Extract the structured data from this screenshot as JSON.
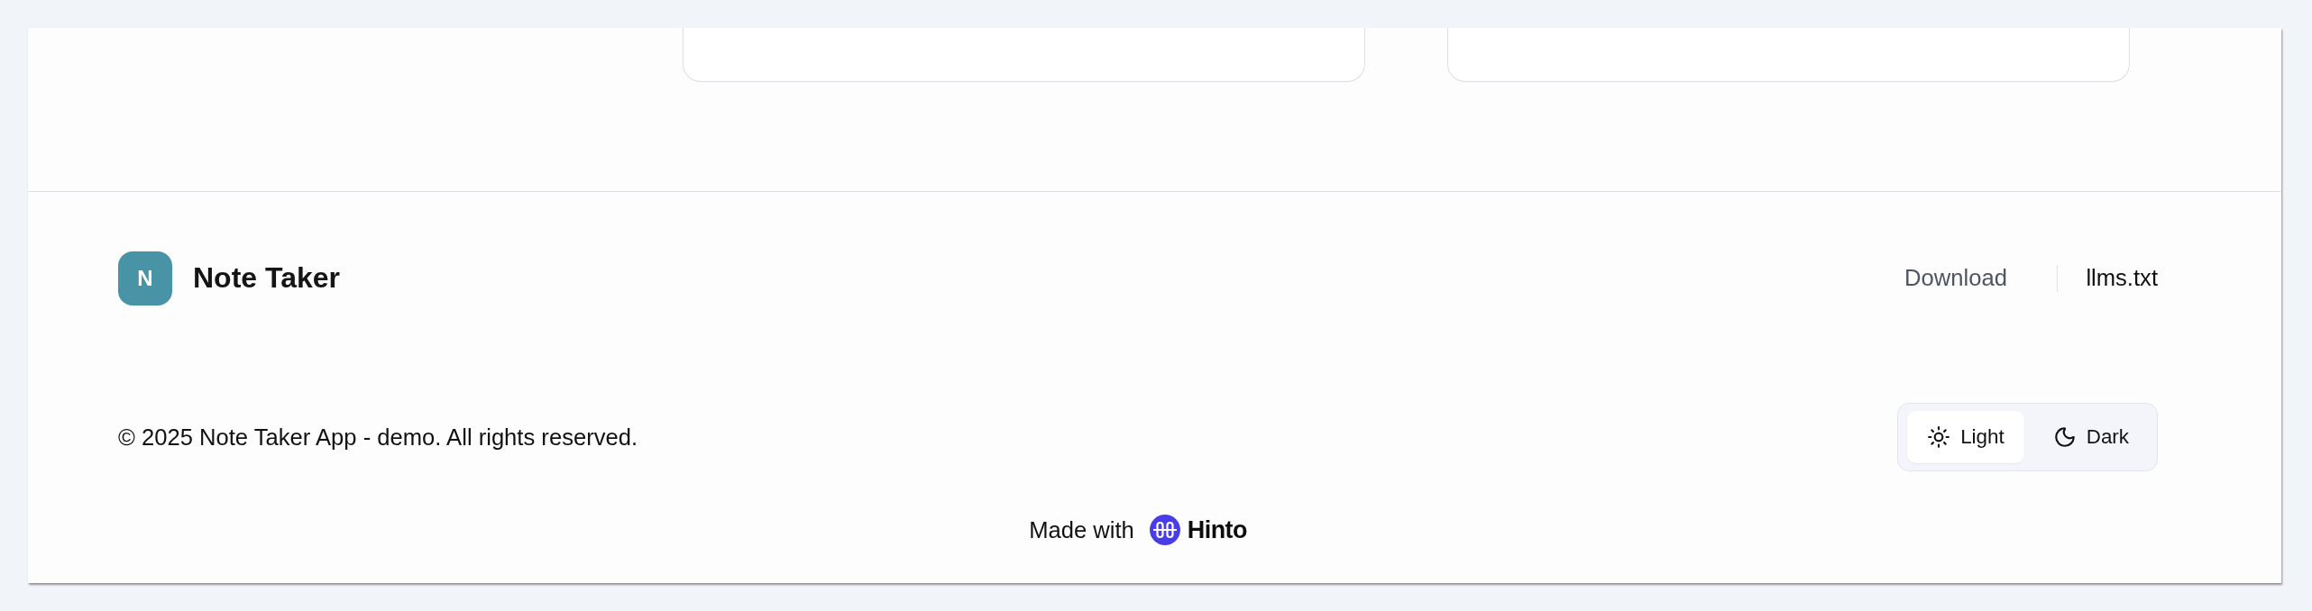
{
  "footer": {
    "brand": {
      "logo_letter": "N",
      "name": "Note Taker"
    },
    "links": [
      {
        "label": "Download",
        "hovered": false
      },
      {
        "label": "llms.txt",
        "hovered": true
      }
    ],
    "copyright": "© 2025 Note Taker App - demo. All rights reserved.",
    "theme_toggle": [
      {
        "kind": "light",
        "label": "Light",
        "selected": true
      },
      {
        "kind": "dark",
        "label": "Dark",
        "selected": false
      }
    ],
    "made_with": {
      "label": "Made with",
      "brand": "Hinto"
    }
  }
}
